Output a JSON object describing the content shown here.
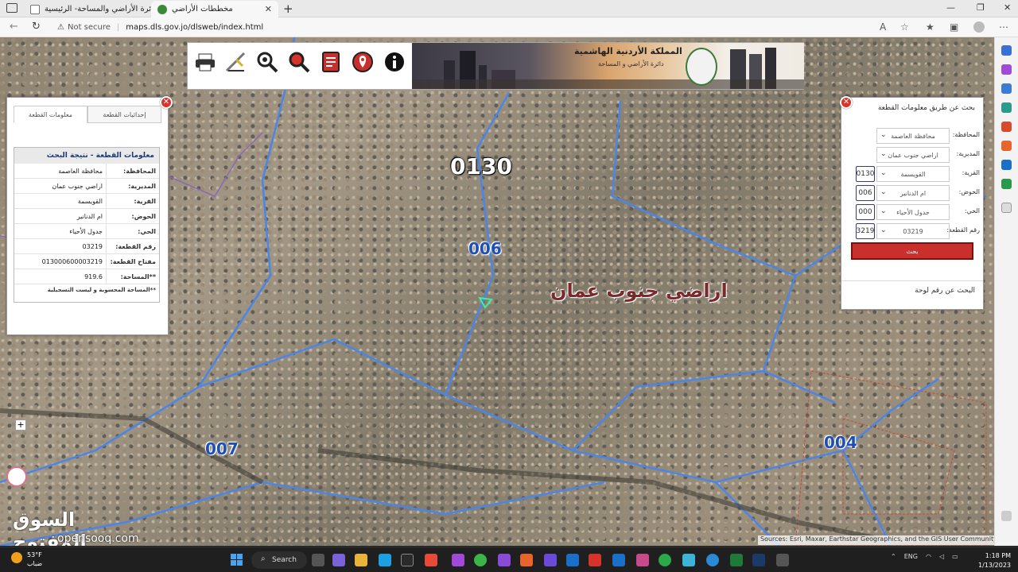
{
  "browser": {
    "tabs": [
      {
        "title": "دائرة الأراضي والمساحة- الرئيسية",
        "active": false
      },
      {
        "title": "مخططات الأراضي",
        "active": true
      }
    ],
    "new_tab": "+",
    "security": "Not secure",
    "url": "maps.dls.gov.jo/dlsweb/index.html"
  },
  "header": {
    "kingdom_title": "المملكة الأردنية الهاشمية",
    "department": "دائرة الأراضي و المساحة",
    "tools": [
      "print-icon",
      "measure-icon",
      "search-location-icon",
      "search-icon",
      "report-icon",
      "location-pin-icon",
      "info-icon"
    ]
  },
  "left_panel": {
    "tabs": [
      "إحداثيات القطعة",
      "معلومات القطعة"
    ],
    "result_title": "معلومات القطعة - نتيجة البحث",
    "rows": [
      {
        "key": "المحافظة:",
        "value": "محافظة العاصمة"
      },
      {
        "key": "المديرية:",
        "value": "اراضي جنوب عمان"
      },
      {
        "key": "القرية:",
        "value": "القويسمة"
      },
      {
        "key": "الحوض:",
        "value": "ام الدنانير"
      },
      {
        "key": "الحي:",
        "value": "جدول الأحياء"
      },
      {
        "key": "رقم القطعة:",
        "value": "03219"
      },
      {
        "key": "مفتاح القطعة:",
        "value": "013000600003219"
      },
      {
        "key": "**المساحة:",
        "value": "919.6"
      }
    ],
    "note": "**المساحة المحسوبة و ليست التسجيلية"
  },
  "right_panel": {
    "title": "بحث عن طريق معلومات القطعة",
    "fields": [
      {
        "label": "المحافظة:",
        "value": "محافظة العاصمة",
        "code": ""
      },
      {
        "label": "المديرية:",
        "value": "اراضي جنوب عمان",
        "code": ""
      },
      {
        "label": "القرية:",
        "value": "القويسمة",
        "code": "0130"
      },
      {
        "label": "الحوض:",
        "value": "ام الدنانير",
        "code": "006"
      },
      {
        "label": "الحي:",
        "value": "جدول الأحياء",
        "code": "000"
      },
      {
        "label": "رقم القطعة:",
        "value": "03219",
        "code": "3219"
      }
    ],
    "search_label": "بحث",
    "plate_search": "البحث عن رقم لوحة"
  },
  "map": {
    "labels": {
      "village_code": "0130",
      "basin_code": "006",
      "district_name": "اراضي جنوب عمان",
      "left_code": "007",
      "right_code": "004"
    },
    "zoom_in": "+",
    "attribution": "Sources: Esri, Maxar, Earthstar Geographics, and the GIS User Community"
  },
  "watermark": {
    "arabic": "السوق المفتوح",
    "latin": "opensooq.com"
  },
  "taskbar": {
    "temperature": "53°F",
    "condition": "ضباب",
    "search": "Search",
    "language": "ENG",
    "time": "1:18 PM",
    "date": "1/13/2023"
  },
  "colors": {
    "parcel_boundary": "#4a86e8",
    "search_button": "#c9302c",
    "close_button": "#d9332b"
  }
}
